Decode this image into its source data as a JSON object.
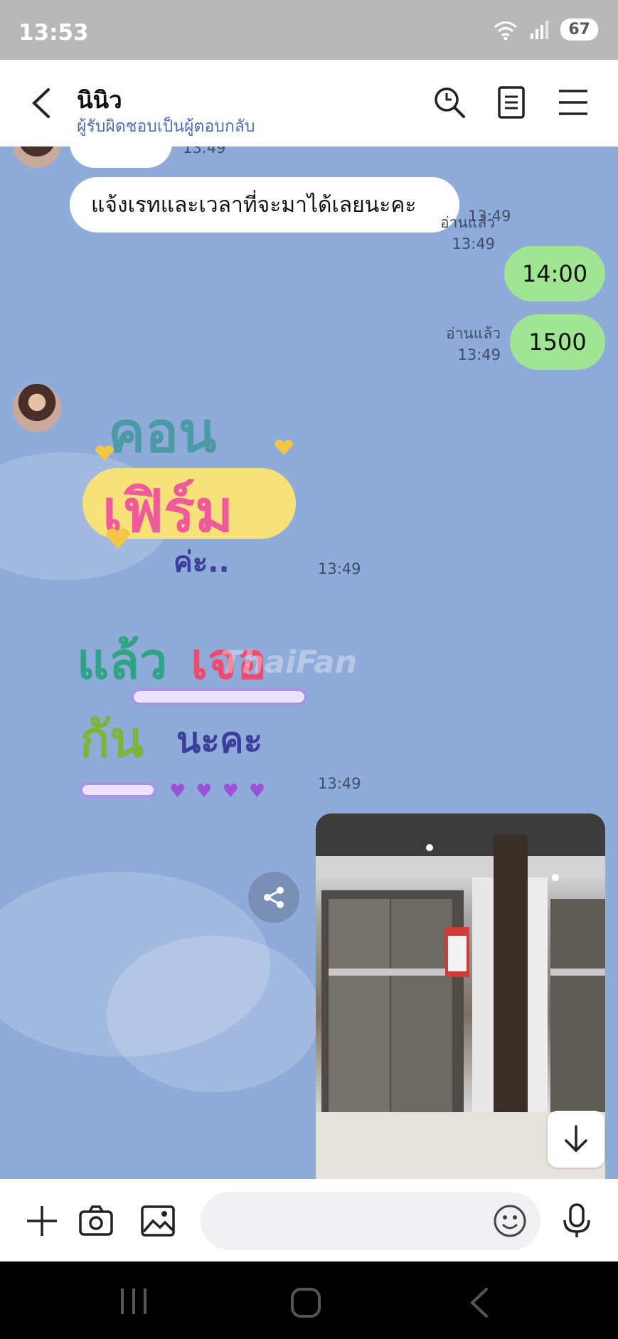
{
  "status_bar": {
    "time": "13:53",
    "battery": "67",
    "wifi_label": "6"
  },
  "header": {
    "title": "นินิว",
    "subtitle": "ผู้รับผิดชอบเป็นผู้ตอบกลับ",
    "icons": [
      "back-icon",
      "search-icon",
      "notes-icon",
      "menu-icon"
    ]
  },
  "messages": {
    "partial_time": "13:49",
    "m1": {
      "text": "แจ้งเรทและเวลาที่จะมาได้เลยนะคะ",
      "time": "13:49"
    },
    "m2": {
      "text": "14:00",
      "read": "อ่านแล้ว",
      "time": "13:49"
    },
    "m3": {
      "text": "1500",
      "read": "อ่านแล้ว",
      "time": "13:49"
    },
    "sticker1": {
      "line1": "คอน",
      "line2": "เฟิร์ม",
      "line3": "ค่ะ..",
      "time": "13:49"
    },
    "sticker2": {
      "line1a": "แล้ว",
      "line1b": "เจอ",
      "line2a": "กัน",
      "line2b": "นะคะ",
      "time": "13:49"
    },
    "watermark": "ThaiFan"
  },
  "input": {
    "placeholder": ""
  },
  "colors": {
    "chat_bg": "#8fabd9",
    "outgoing_bubble": "#9fe594",
    "incoming_bubble": "#ffffff",
    "accent": "#4a6fb3"
  }
}
